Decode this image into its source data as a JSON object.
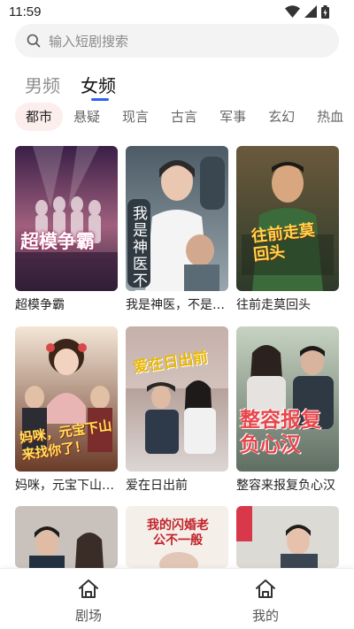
{
  "status_bar": {
    "time": "11:59"
  },
  "search": {
    "placeholder": "输入短剧搜索"
  },
  "gender_tabs": [
    {
      "label": "男频",
      "active": false
    },
    {
      "label": "女频",
      "active": true
    }
  ],
  "genres": [
    {
      "label": "都市",
      "active": true
    },
    {
      "label": "悬疑",
      "active": false
    },
    {
      "label": "现言",
      "active": false
    },
    {
      "label": "古言",
      "active": false
    },
    {
      "label": "军事",
      "active": false
    },
    {
      "label": "玄幻",
      "active": false
    },
    {
      "label": "热血",
      "active": false
    }
  ],
  "dramas": [
    {
      "title": "超模争霸",
      "poster_text": "超模争霸"
    },
    {
      "title": "我是神医，不是圣人",
      "poster_text": "我是神医 不是圣人"
    },
    {
      "title": "往前走莫回头",
      "poster_text": "往前走莫回头"
    },
    {
      "title": "妈咪，元宝下山来找你了",
      "poster_text": "妈咪，元宝下山来找你了！"
    },
    {
      "title": "爱在日出前",
      "poster_text": "爱在日出前"
    },
    {
      "title": "整容来报复负心汉",
      "poster_text": "整容报复负心汉"
    },
    {
      "title": "",
      "poster_text": ""
    },
    {
      "title": "",
      "poster_text": "我的闪婚老公不一般"
    },
    {
      "title": "",
      "poster_text": ""
    }
  ],
  "bottom_nav": [
    {
      "label": "剧场",
      "icon": "home-icon"
    },
    {
      "label": "我的",
      "icon": "home-icon"
    }
  ],
  "colors": {
    "accent": "#2b64f0",
    "active_genre_bg": "#fdeeee"
  }
}
